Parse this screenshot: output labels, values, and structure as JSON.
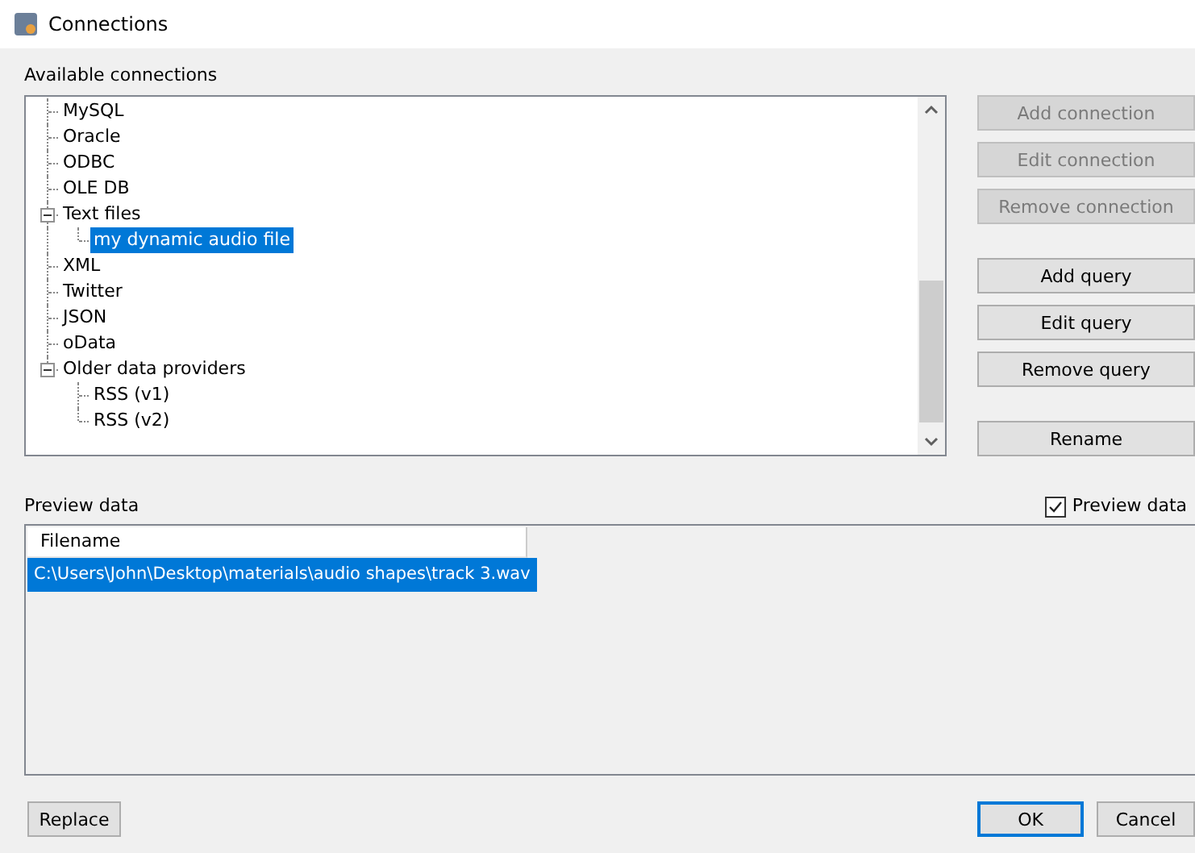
{
  "window": {
    "title": "Connections"
  },
  "connections": {
    "label": "Available connections",
    "tree": [
      {
        "label": "MySQL",
        "selected": false
      },
      {
        "label": "Oracle",
        "selected": false
      },
      {
        "label": "ODBC",
        "selected": false
      },
      {
        "label": "OLE DB",
        "selected": false
      },
      {
        "label": "Text files",
        "selected": false,
        "expanded": true,
        "children": [
          {
            "label": "my dynamic audio file",
            "selected": true
          }
        ]
      },
      {
        "label": "XML",
        "selected": false
      },
      {
        "label": "Twitter",
        "selected": false
      },
      {
        "label": "JSON",
        "selected": false
      },
      {
        "label": "oData",
        "selected": false
      },
      {
        "label": "Older data providers",
        "selected": false,
        "expanded": true,
        "children": [
          {
            "label": "RSS (v1)",
            "selected": false
          },
          {
            "label": "RSS (v2)",
            "selected": false
          }
        ]
      }
    ]
  },
  "side_buttons": [
    [
      {
        "label": "Add connection",
        "disabled": true
      },
      {
        "label": "Edit connection",
        "disabled": true
      },
      {
        "label": "Remove connection",
        "disabled": true
      }
    ],
    [
      {
        "label": "Add query",
        "disabled": false
      },
      {
        "label": "Edit query",
        "disabled": false
      },
      {
        "label": "Remove query",
        "disabled": false
      }
    ],
    [
      {
        "label": "Rename",
        "disabled": false
      }
    ]
  ],
  "preview": {
    "label": "Preview data",
    "checkbox": {
      "label": "Preview data",
      "checked": true
    },
    "columns": [
      "Filename"
    ],
    "rows": [
      {
        "cells": [
          "C:\\Users\\John\\Desktop\\materials\\audio shapes\\track 3.wav"
        ],
        "selected": true
      }
    ]
  },
  "footer": {
    "replace": "Replace",
    "ok": "OK",
    "cancel": "Cancel"
  }
}
